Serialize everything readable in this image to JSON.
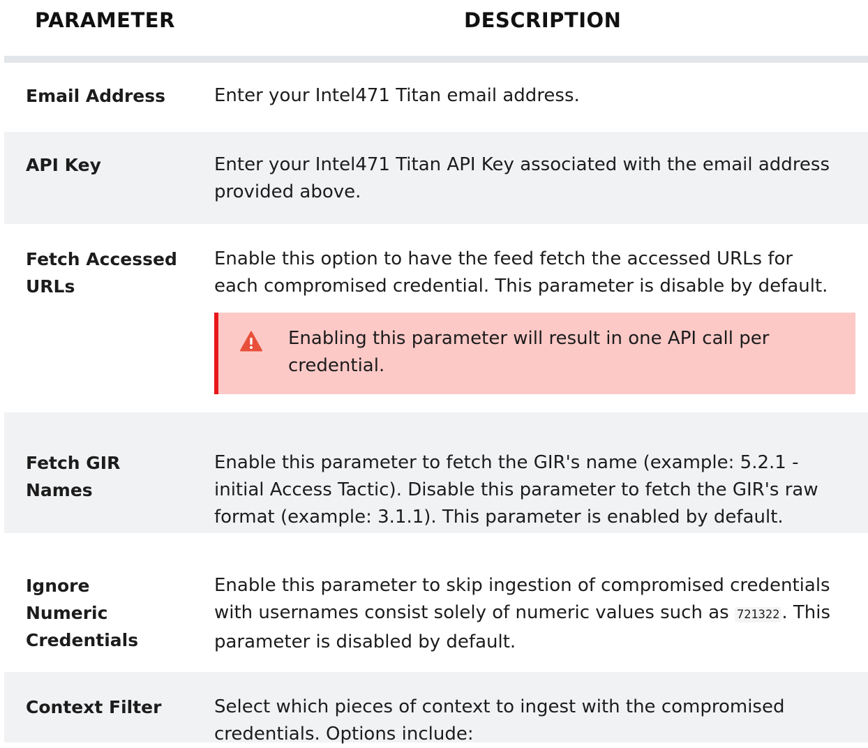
{
  "header": {
    "parameter": "PARAMETER",
    "description": "DESCRIPTION"
  },
  "rows": [
    {
      "parameter": "Email Address",
      "description": "Enter your Intel471 Titan email address."
    },
    {
      "parameter": "API Key",
      "description": "Enter your Intel471 Titan API Key associated with the email address provided above."
    },
    {
      "parameter": "Fetch Accessed URLs",
      "description": "Enable this option to have the feed fetch the accessed URLs for each compromised credential.  This parameter is disable by default.",
      "warning": "Enabling this parameter will result in one API call per credential."
    },
    {
      "parameter": "Fetch GIR Names",
      "description": "Enable this parameter to fetch the GIR's name (example: 5.2.1 - initial Access Tactic).  Disable this parameter to fetch the GIR's raw format (example: 3.1.1).  This parameter is enabled by default."
    },
    {
      "parameter": "Ignore Numeric Credentials",
      "description_before": "Enable this parameter to skip ingestion of compromised credentials with usernames consist solely of numeric values such as ",
      "code": "721322",
      "description_after": ".  This parameter is disabled by default."
    },
    {
      "parameter": "Context Filter",
      "description": "Select which pieces of context to ingest with the compromised credentials. Options include:"
    }
  ],
  "colors": {
    "row_alt": "#f1f2f4",
    "divider": "#e2e5ea",
    "warning_bg": "#fcc9c7",
    "warning_border": "#e8171a",
    "warning_icon": "#e8503a"
  },
  "icons": {
    "warning": "warning-triangle-icon"
  }
}
